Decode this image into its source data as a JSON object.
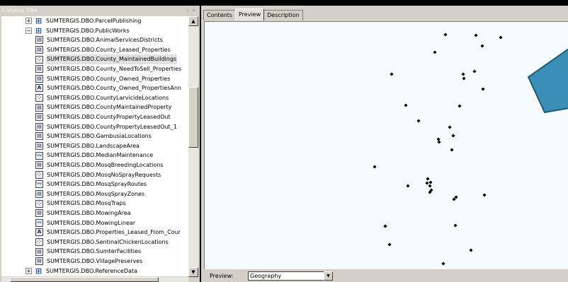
{
  "catalog": {
    "title": "Catalog Tree",
    "pin_glyph": "ı",
    "close_glyph": "×",
    "items": [
      {
        "label": "SUMTERGIS.DBO.ParcelPublishing",
        "type": "dataset",
        "expander": "+",
        "level": 0
      },
      {
        "label": "SUMTERGIS.DBO.PublicWorks",
        "type": "dataset",
        "expander": "−",
        "level": 0
      },
      {
        "label": "SUMTERGIS.DBO.AnimalServicesDistricts",
        "type": "polygon",
        "level": 1
      },
      {
        "label": "SUMTERGIS.DBO.County_Leased_Properties",
        "type": "polygon",
        "level": 1
      },
      {
        "label": "SUMTERGIS.DBO.County_MaintainedBuildings",
        "type": "point",
        "level": 1,
        "selected": true
      },
      {
        "label": "SUMTERGIS.DBO.County_NeedToSell_Properties",
        "type": "polygon",
        "level": 1
      },
      {
        "label": "SUMTERGIS.DBO.County_Owned_Properties",
        "type": "polygon",
        "level": 1
      },
      {
        "label": "SUMTERGIS.DBO.County_Owned_PropertiesAnn",
        "type": "annotation",
        "level": 1
      },
      {
        "label": "SUMTERGIS.DBO.CountyLarvicideLocations",
        "type": "point",
        "level": 1
      },
      {
        "label": "SUMTERGIS.DBO.CountyMaintainedProperty",
        "type": "polygon",
        "level": 1
      },
      {
        "label": "SUMTERGIS.DBO.CountyPropertyLeasedOut",
        "type": "polygon",
        "level": 1
      },
      {
        "label": "SUMTERGIS.DBO.CountyPropertyLeasedOut_1",
        "type": "polygon",
        "level": 1
      },
      {
        "label": "SUMTERGIS.DBO.GambusiaLocations",
        "type": "polygon",
        "level": 1
      },
      {
        "label": "SUMTERGIS.DBO.LandscapeArea",
        "type": "polygon",
        "level": 1
      },
      {
        "label": "SUMTERGIS.DBO.MedianMaintenance",
        "type": "line",
        "level": 1
      },
      {
        "label": "SUMTERGIS.DBO.MosqBreedingLocations",
        "type": "polygon",
        "level": 1
      },
      {
        "label": "SUMTERGIS.DBO.MosqNoSprayRequests",
        "type": "point",
        "level": 1
      },
      {
        "label": "SUMTERGIS.DBO.MosqSprayRoutes",
        "type": "line",
        "level": 1
      },
      {
        "label": "SUMTERGIS.DBO.MosqSprayZones",
        "type": "polygon",
        "level": 1
      },
      {
        "label": "SUMTERGIS.DBO.MosqTraps",
        "type": "point",
        "level": 1
      },
      {
        "label": "SUMTERGIS.DBO.MowingArea",
        "type": "polygon",
        "level": 1
      },
      {
        "label": "SUMTERGIS.DBO.MowingLinear",
        "type": "line",
        "level": 1
      },
      {
        "label": "SUMTERGIS.DBO.Properties_Leased_From_Cour",
        "type": "annotation",
        "level": 1
      },
      {
        "label": "SUMTERGIS.DBO.SentinalChickenLocations",
        "type": "point",
        "level": 1
      },
      {
        "label": "SUMTERGIS.DBO.SumterFacilities",
        "type": "polygon",
        "level": 1
      },
      {
        "label": "SUMTERGIS.DBO.VillagePreserves",
        "type": "polygon",
        "level": 1
      },
      {
        "label": "SUMTERGIS.DBO.ReferenceData",
        "type": "dataset",
        "expander": "+",
        "level": 0
      }
    ],
    "icon_glyphs": {
      "polygon": "▤",
      "point": "⁘",
      "line": "〰",
      "annotation": "A",
      "dataset": "⊞"
    }
  },
  "tabs": [
    {
      "label": "Contents",
      "active": false
    },
    {
      "label": "Preview",
      "active": true
    },
    {
      "label": "Description",
      "active": false
    }
  ],
  "preview": {
    "label": "Preview:",
    "selected_option": "Geography"
  },
  "scroll_glyphs": {
    "up": "▲",
    "down": "▼",
    "left": "◄",
    "right": "►"
  },
  "colors": {
    "map_background": "#f6fcfd",
    "point_marker": "#000000",
    "highlight_shape_fill": "#3a8fb7",
    "highlight_shape_stroke": "#1e5a77",
    "selected_row": "#e1e1e1"
  }
}
